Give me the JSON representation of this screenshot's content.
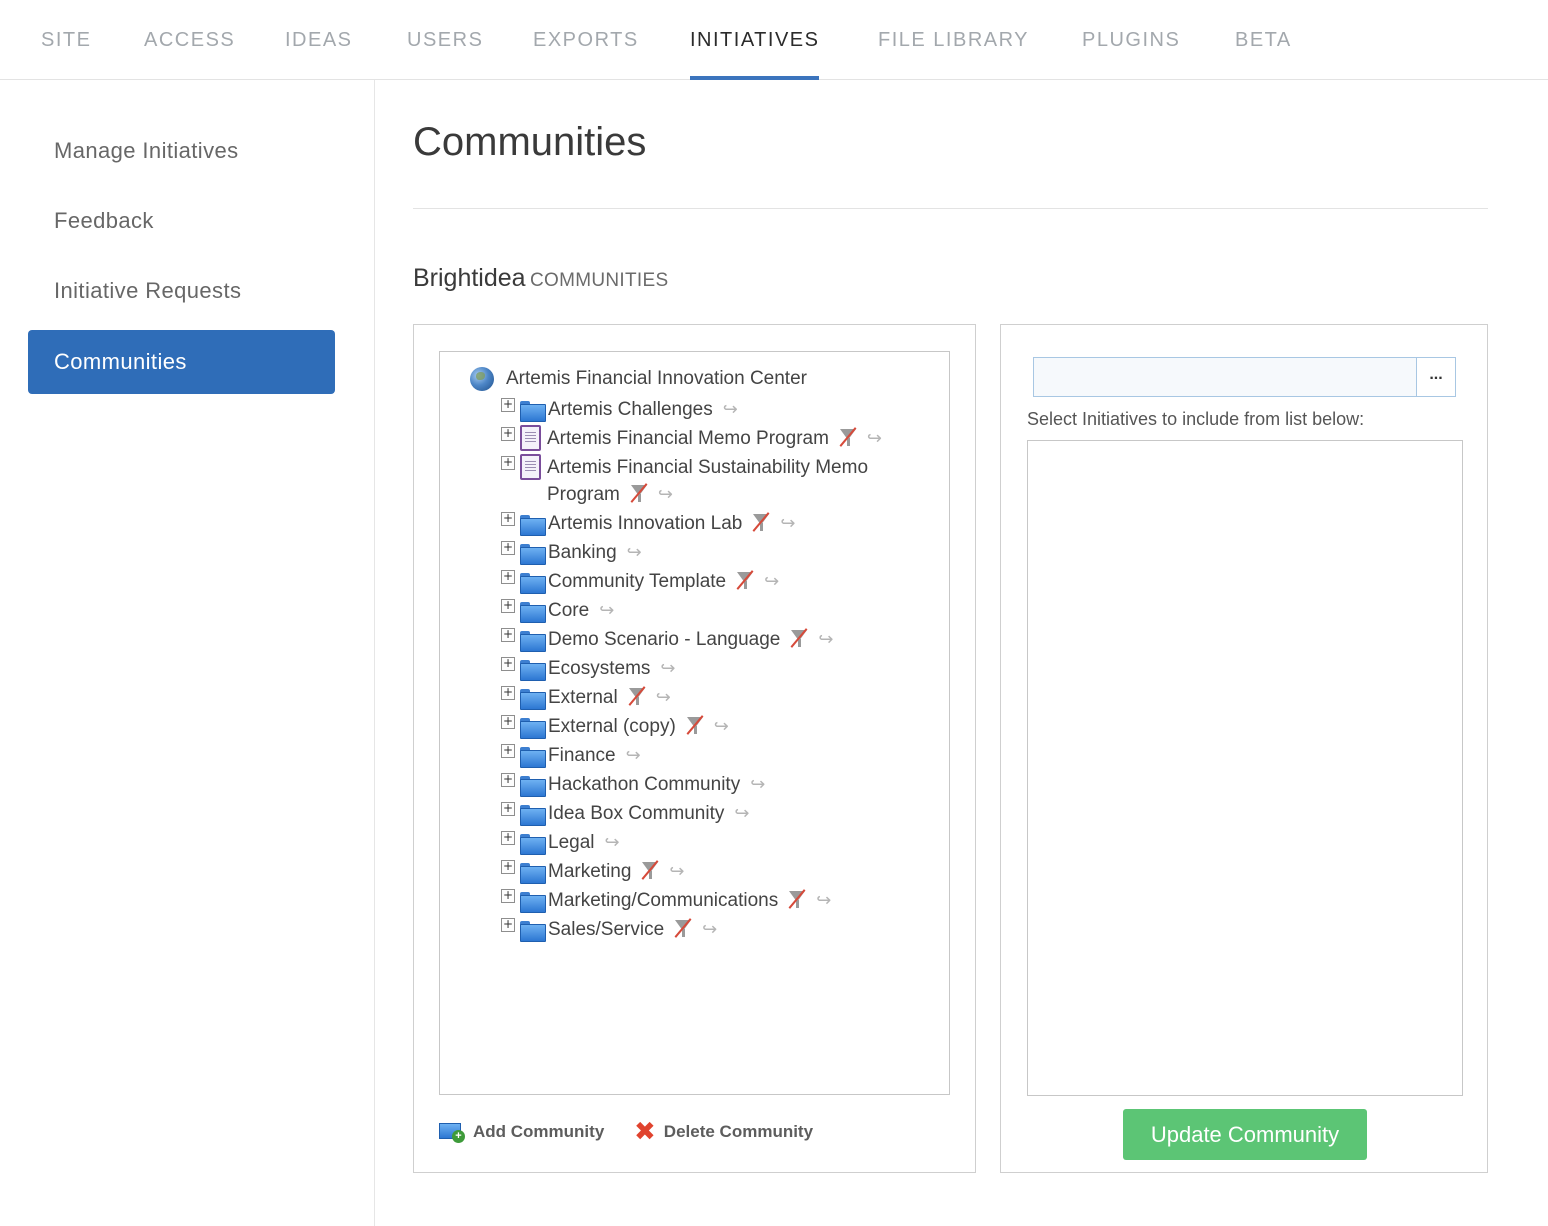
{
  "nav": {
    "tabs": [
      {
        "label": "SITE"
      },
      {
        "label": "ACCESS"
      },
      {
        "label": "IDEAS"
      },
      {
        "label": "USERS"
      },
      {
        "label": "EXPORTS"
      },
      {
        "label": "INITIATIVES",
        "active": true
      },
      {
        "label": "FILE LIBRARY"
      },
      {
        "label": "PLUGINS"
      },
      {
        "label": "BETA"
      }
    ]
  },
  "sidebar": {
    "items": [
      {
        "label": "Manage Initiatives"
      },
      {
        "label": "Feedback"
      },
      {
        "label": "Initiative Requests"
      },
      {
        "label": "Communities",
        "active": true
      }
    ]
  },
  "main": {
    "title": "Communities",
    "section_brand": "Brightidea",
    "section_sub": "COMMUNITIES"
  },
  "tree": {
    "root": "Artemis Financial Innovation Center",
    "items": [
      {
        "label": "Artemis Challenges",
        "icon": "folder",
        "filter_off": false
      },
      {
        "label": "Artemis Financial Memo Program",
        "icon": "memo",
        "filter_off": true
      },
      {
        "label": "Artemis Financial Sustainability Memo Program",
        "icon": "memo",
        "filter_off": true
      },
      {
        "label": "Artemis Innovation Lab",
        "icon": "folder",
        "filter_off": true
      },
      {
        "label": "Banking",
        "icon": "folder",
        "filter_off": false
      },
      {
        "label": "Community Template",
        "icon": "folder",
        "filter_off": true
      },
      {
        "label": "Core",
        "icon": "folder",
        "filter_off": false
      },
      {
        "label": "Demo Scenario - Language",
        "icon": "folder",
        "filter_off": true
      },
      {
        "label": "Ecosystems",
        "icon": "folder",
        "filter_off": false
      },
      {
        "label": "External",
        "icon": "folder",
        "filter_off": true
      },
      {
        "label": "External (copy)",
        "icon": "folder",
        "filter_off": true
      },
      {
        "label": "Finance",
        "icon": "folder",
        "filter_off": false
      },
      {
        "label": "Hackathon Community",
        "icon": "folder",
        "filter_off": false
      },
      {
        "label": "Idea Box Community",
        "icon": "folder",
        "filter_off": false
      },
      {
        "label": "Legal",
        "icon": "folder",
        "filter_off": false
      },
      {
        "label": "Marketing",
        "icon": "folder",
        "filter_off": true
      },
      {
        "label": "Marketing/Communications",
        "icon": "folder",
        "filter_off": true
      },
      {
        "label": "Sales/Service",
        "icon": "folder",
        "filter_off": true
      }
    ]
  },
  "actions": {
    "add_label": "Add Community",
    "delete_label": "Delete Community"
  },
  "right": {
    "search_value": "",
    "browse_label": "...",
    "select_label": "Select Initiatives to include from list below:",
    "update_label": "Update Community"
  },
  "colors": {
    "accent": "#2f6db8",
    "tab_underline": "#3b74bd",
    "update_button": "#5cc575",
    "delete_icon": "#e0432e"
  }
}
